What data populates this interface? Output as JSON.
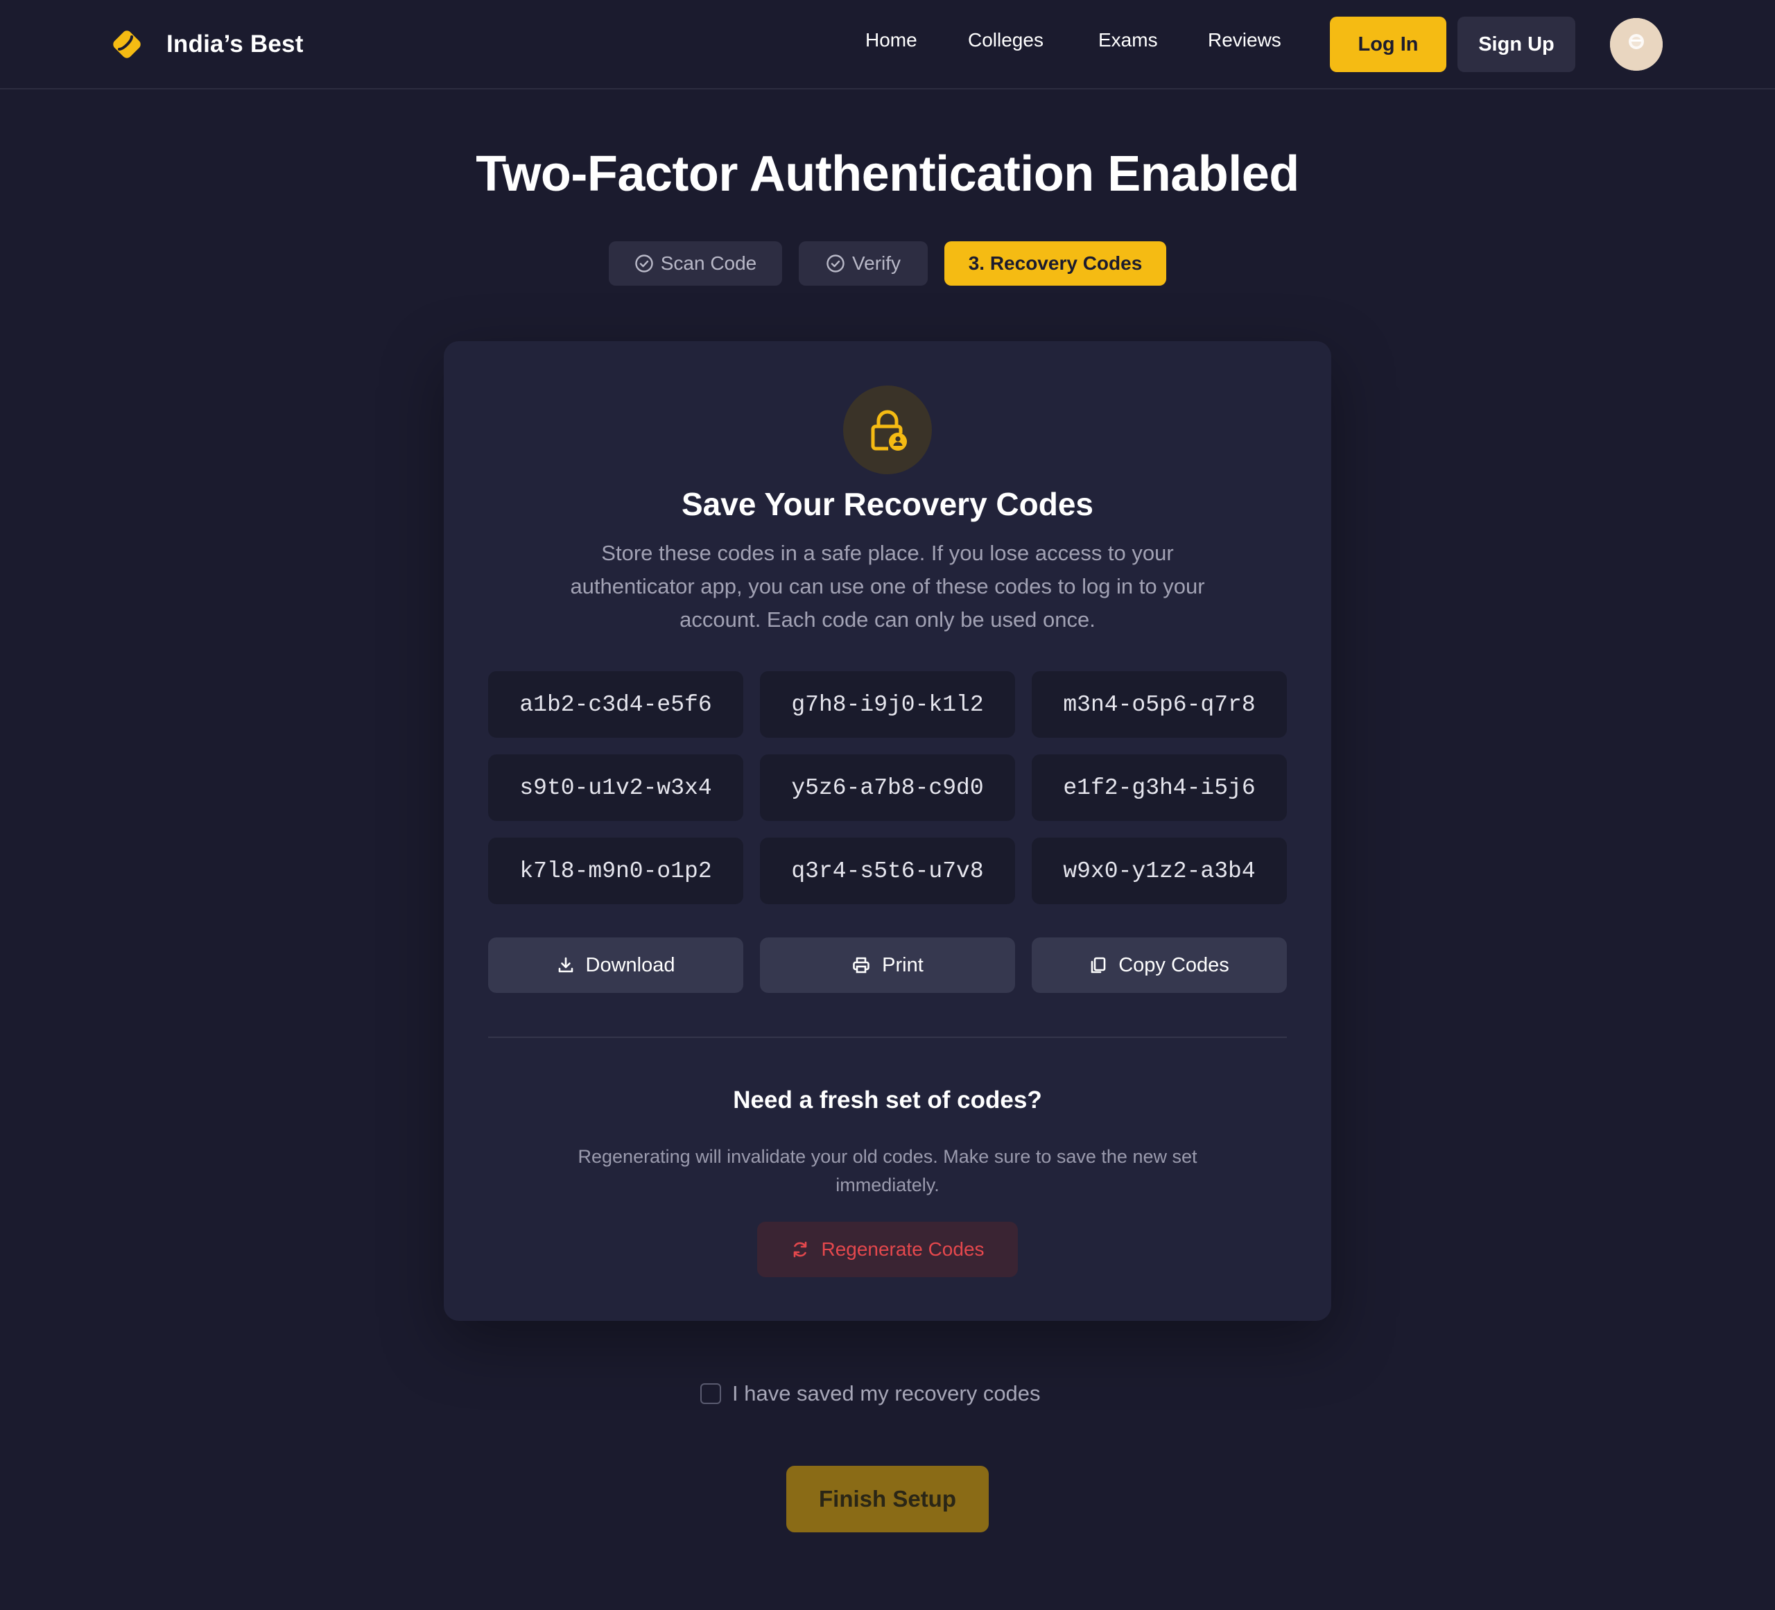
{
  "header": {
    "brand_name": "India’s Best",
    "nav": [
      "Home",
      "Colleges",
      "Exams",
      "Reviews"
    ],
    "login_label": "Log In",
    "signup_label": "Sign Up"
  },
  "page": {
    "title": "Two-Factor Authentication Enabled",
    "steps": [
      {
        "label": "Scan Code",
        "state": "done"
      },
      {
        "label": "Verify",
        "state": "done"
      },
      {
        "label": "3. Recovery Codes",
        "state": "active"
      }
    ]
  },
  "card": {
    "title": "Save Your Recovery Codes",
    "description": "Store these codes in a safe place. If you lose access to your authenticator app, you can use one of these codes to log in to your account. Each code can only be used once.",
    "codes": [
      "a1b2-c3d4-e5f6",
      "g7h8-i9j0-k1l2",
      "m3n4-o5p6-q7r8",
      "s9t0-u1v2-w3x4",
      "y5z6-a7b8-c9d0",
      "e1f2-g3h4-i5j6",
      "k7l8-m9n0-o1p2",
      "q3r4-s5t6-u7v8",
      "w9x0-y1z2-a3b4"
    ],
    "actions": {
      "download": "Download",
      "print": "Print",
      "copy": "Copy Codes"
    },
    "regen_title": "Need a fresh set of codes?",
    "regen_desc": "Regenerating will invalidate your old codes. Make sure to save the new set immediately.",
    "regen_label": "Regenerate Codes"
  },
  "footer": {
    "confirm_label": "I have saved my recovery codes",
    "confirm_checked": false,
    "finish_label": "Finish Setup"
  },
  "colors": {
    "background": "#1b1b2e",
    "accent": "#f5bb13",
    "danger": "#e5484d",
    "card": "#22233a"
  }
}
